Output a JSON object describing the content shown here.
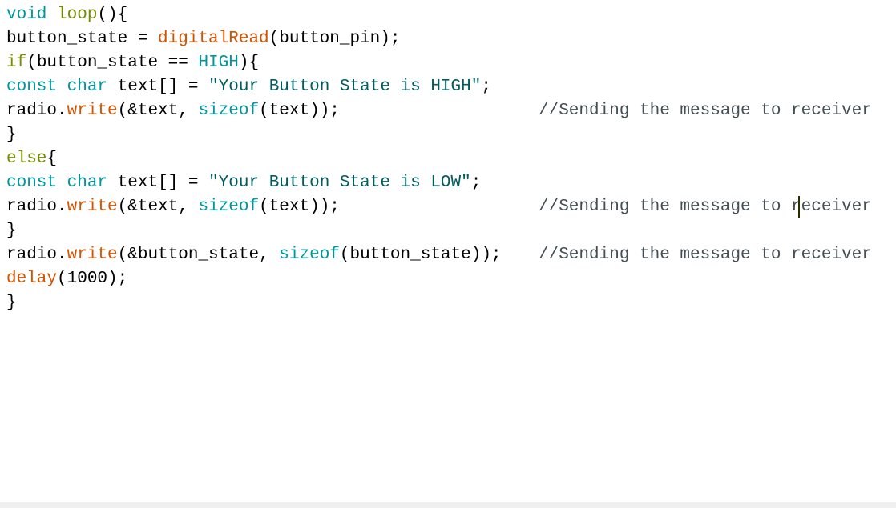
{
  "editor": {
    "lines": [
      [
        {
          "t": "void",
          "c": "kw"
        },
        {
          "t": " ",
          "c": "plain"
        },
        {
          "t": "loop",
          "c": "ctl"
        },
        {
          "t": "(){",
          "c": "plain"
        }
      ],
      [
        {
          "t": "button_state = ",
          "c": "plain"
        },
        {
          "t": "digitalRead",
          "c": "fn"
        },
        {
          "t": "(button_pin);",
          "c": "plain"
        }
      ],
      [
        {
          "t": "if",
          "c": "ctl"
        },
        {
          "t": "(button_state == ",
          "c": "plain"
        },
        {
          "t": "HIGH",
          "c": "kw"
        },
        {
          "t": "){",
          "c": "plain"
        }
      ],
      [
        {
          "t": "const",
          "c": "kw"
        },
        {
          "t": " ",
          "c": "plain"
        },
        {
          "t": "char",
          "c": "kw"
        },
        {
          "t": " text[] = ",
          "c": "plain"
        },
        {
          "t": "\"Your Button State is HIGH\"",
          "c": "str"
        },
        {
          "t": ";",
          "c": "plain"
        }
      ],
      [
        {
          "t": "radio.",
          "c": "plain"
        },
        {
          "t": "write",
          "c": "fn"
        },
        {
          "t": "(&text, ",
          "c": "plain"
        },
        {
          "t": "sizeof",
          "c": "kw"
        },
        {
          "t": "(text));",
          "c": "plain"
        }
      ],
      [
        {
          "t": "}",
          "c": "plain"
        }
      ],
      [
        {
          "t": "else",
          "c": "ctl"
        },
        {
          "t": "{",
          "c": "plain"
        }
      ],
      [
        {
          "t": "const",
          "c": "kw"
        },
        {
          "t": " ",
          "c": "plain"
        },
        {
          "t": "char",
          "c": "kw"
        },
        {
          "t": " text[] = ",
          "c": "plain"
        },
        {
          "t": "\"Your Button State is LOW\"",
          "c": "str"
        },
        {
          "t": ";",
          "c": "plain"
        }
      ],
      [
        {
          "t": "radio.",
          "c": "plain"
        },
        {
          "t": "write",
          "c": "fn"
        },
        {
          "t": "(&text, ",
          "c": "plain"
        },
        {
          "t": "sizeof",
          "c": "kw"
        },
        {
          "t": "(text));",
          "c": "plain"
        }
      ],
      [
        {
          "t": "}",
          "c": "plain"
        }
      ],
      [
        {
          "t": "radio.",
          "c": "plain"
        },
        {
          "t": "write",
          "c": "fn"
        },
        {
          "t": "(&button_state, ",
          "c": "plain"
        },
        {
          "t": "sizeof",
          "c": "kw"
        },
        {
          "t": "(button_state));",
          "c": "plain"
        }
      ],
      [
        {
          "t": "delay",
          "c": "fn"
        },
        {
          "t": "(1000);",
          "c": "plain"
        }
      ],
      [
        {
          "t": "}",
          "c": "plain"
        }
      ]
    ],
    "comments": {
      "line_4": "//Sending the message to receiver",
      "line_8": "//Sending the message to receiver",
      "line_10": "//Sending the message to receiver"
    }
  }
}
